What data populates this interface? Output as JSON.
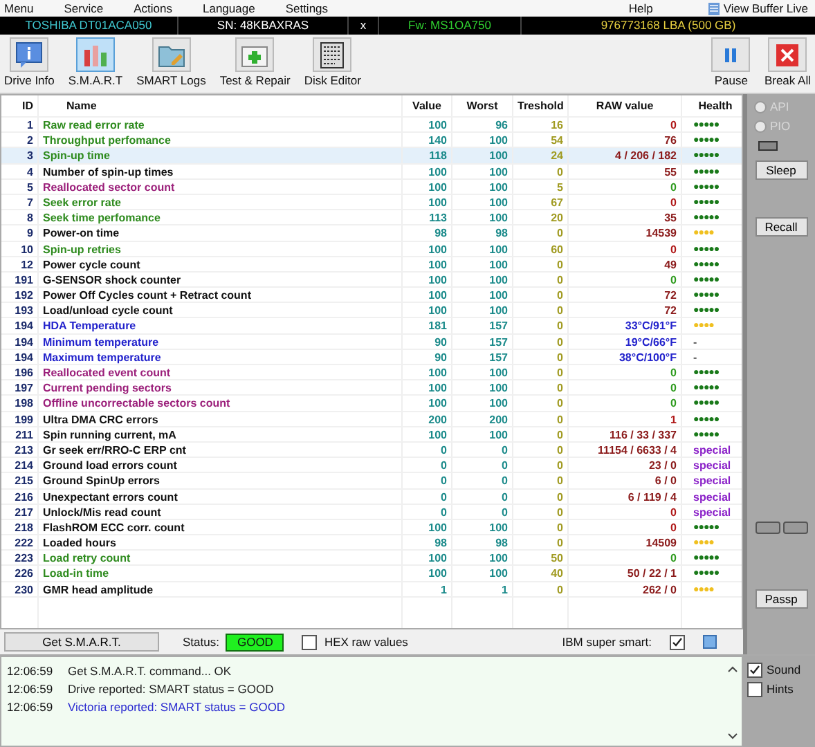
{
  "menu": [
    "Menu",
    "Service",
    "Actions",
    "Language",
    "Settings",
    "Help"
  ],
  "view_buffer": "View Buffer Live",
  "drive": {
    "model": "TOSHIBA DT01ACA050",
    "serial": "SN: 48KBAXRAS",
    "close": "x",
    "firmware": "Fw: MS1OA750",
    "capacity": "976773168 LBA (500 GB)"
  },
  "toolbar": [
    {
      "label": "Drive Info",
      "kind": "info",
      "selected": false
    },
    {
      "label": "S.M.A.R.T",
      "kind": "smart",
      "selected": true
    },
    {
      "label": "SMART Logs",
      "kind": "logs",
      "selected": false
    },
    {
      "label": "Test & Repair",
      "kind": "test",
      "selected": false
    },
    {
      "label": "Disk Editor",
      "kind": "editor",
      "selected": false
    }
  ],
  "toolbar_right": [
    {
      "label": "Pause",
      "kind": "pause"
    },
    {
      "label": "Break All",
      "kind": "break"
    }
  ],
  "table": {
    "columns": [
      "ID",
      "Name",
      "Value",
      "Worst",
      "Treshold",
      "RAW value",
      "Health"
    ],
    "rows": [
      {
        "id": "1",
        "name": {
          "text": "Raw read error rate",
          "color": "#2e8b1e"
        },
        "value": "100",
        "worst": "96",
        "threshold": "16",
        "raw": {
          "text": "0",
          "color": "#b01818"
        },
        "health": {
          "text": "●●●●●",
          "kind": "good"
        },
        "selected": false
      },
      {
        "id": "2",
        "name": {
          "text": "Throughput perfomance",
          "color": "#2e8b1e"
        },
        "value": "140",
        "worst": "100",
        "threshold": "54",
        "raw": {
          "text": "76",
          "color": "#8b1a1a"
        },
        "health": {
          "text": "●●●●●",
          "kind": "good"
        },
        "selected": false
      },
      {
        "id": "3",
        "name": {
          "text": "Spin-up time",
          "color": "#2e8b1e"
        },
        "value": "118",
        "worst": "100",
        "threshold": "24",
        "raw": {
          "text": "4 / 206 / 182",
          "color": "#8b1a1a"
        },
        "health": {
          "text": "●●●●●",
          "kind": "good"
        },
        "selected": true
      },
      {
        "id": "4",
        "name": {
          "text": "Number of spin-up times",
          "color": "#111111"
        },
        "value": "100",
        "worst": "100",
        "threshold": "0",
        "raw": {
          "text": "55",
          "color": "#8b1a1a"
        },
        "health": {
          "text": "●●●●●",
          "kind": "good"
        },
        "selected": false
      },
      {
        "id": "5",
        "name": {
          "text": "Reallocated sector count",
          "color": "#9b1f7a"
        },
        "value": "100",
        "worst": "100",
        "threshold": "5",
        "raw": {
          "text": "0",
          "color": "#2e9b1e"
        },
        "health": {
          "text": "●●●●●",
          "kind": "good"
        },
        "selected": false
      },
      {
        "id": "7",
        "name": {
          "text": "Seek error rate",
          "color": "#2e8b1e"
        },
        "value": "100",
        "worst": "100",
        "threshold": "67",
        "raw": {
          "text": "0",
          "color": "#b01818"
        },
        "health": {
          "text": "●●●●●",
          "kind": "good"
        },
        "selected": false
      },
      {
        "id": "8",
        "name": {
          "text": "Seek time perfomance",
          "color": "#2e8b1e"
        },
        "value": "113",
        "worst": "100",
        "threshold": "20",
        "raw": {
          "text": "35",
          "color": "#8b1a1a"
        },
        "health": {
          "text": "●●●●●",
          "kind": "good"
        },
        "selected": false
      },
      {
        "id": "9",
        "name": {
          "text": "Power-on time",
          "color": "#111111"
        },
        "value": "98",
        "worst": "98",
        "threshold": "0",
        "raw": {
          "text": "14539",
          "color": "#8b1a1a"
        },
        "health": {
          "text": "●●●●",
          "kind": "warn"
        },
        "selected": false
      },
      {
        "id": "10",
        "name": {
          "text": "Spin-up retries",
          "color": "#2e8b1e"
        },
        "value": "100",
        "worst": "100",
        "threshold": "60",
        "raw": {
          "text": "0",
          "color": "#b01818"
        },
        "health": {
          "text": "●●●●●",
          "kind": "good"
        },
        "selected": false
      },
      {
        "id": "12",
        "name": {
          "text": "Power cycle count",
          "color": "#111111"
        },
        "value": "100",
        "worst": "100",
        "threshold": "0",
        "raw": {
          "text": "49",
          "color": "#8b1a1a"
        },
        "health": {
          "text": "●●●●●",
          "kind": "good"
        },
        "selected": false
      },
      {
        "id": "191",
        "name": {
          "text": "G-SENSOR shock counter",
          "color": "#111111"
        },
        "value": "100",
        "worst": "100",
        "threshold": "0",
        "raw": {
          "text": "0",
          "color": "#2e9b1e"
        },
        "health": {
          "text": "●●●●●",
          "kind": "good"
        },
        "selected": false
      },
      {
        "id": "192",
        "name": {
          "text": "Power Off Cycles count + Retract count",
          "color": "#111111"
        },
        "value": "100",
        "worst": "100",
        "threshold": "0",
        "raw": {
          "text": "72",
          "color": "#8b1a1a"
        },
        "health": {
          "text": "●●●●●",
          "kind": "good"
        },
        "selected": false
      },
      {
        "id": "193",
        "name": {
          "text": "Load/unload cycle count",
          "color": "#111111"
        },
        "value": "100",
        "worst": "100",
        "threshold": "0",
        "raw": {
          "text": "72",
          "color": "#8b1a1a"
        },
        "health": {
          "text": "●●●●●",
          "kind": "good"
        },
        "selected": false
      },
      {
        "id": "194",
        "name": {
          "text": "HDA Temperature",
          "color": "#2222cc"
        },
        "value": "181",
        "worst": "157",
        "threshold": "0",
        "raw": {
          "text": "33°C/91°F",
          "color": "#2222cc"
        },
        "health": {
          "text": "●●●●",
          "kind": "warn"
        },
        "selected": false
      },
      {
        "id": "194",
        "name": {
          "text": "Minimum temperature",
          "color": "#2222cc"
        },
        "value": "90",
        "worst": "157",
        "threshold": "0",
        "raw": {
          "text": "19°C/66°F",
          "color": "#2222cc"
        },
        "health": {
          "text": "-",
          "kind": "none"
        },
        "selected": false
      },
      {
        "id": "194",
        "name": {
          "text": "Maximum temperature",
          "color": "#2222cc"
        },
        "value": "90",
        "worst": "157",
        "threshold": "0",
        "raw": {
          "text": "38°C/100°F",
          "color": "#2222cc"
        },
        "health": {
          "text": "-",
          "kind": "none"
        },
        "selected": false
      },
      {
        "id": "196",
        "name": {
          "text": "Reallocated event count",
          "color": "#9b1f7a"
        },
        "value": "100",
        "worst": "100",
        "threshold": "0",
        "raw": {
          "text": "0",
          "color": "#2e9b1e"
        },
        "health": {
          "text": "●●●●●",
          "kind": "good"
        },
        "selected": false
      },
      {
        "id": "197",
        "name": {
          "text": "Current pending sectors",
          "color": "#9b1f7a"
        },
        "value": "100",
        "worst": "100",
        "threshold": "0",
        "raw": {
          "text": "0",
          "color": "#2e9b1e"
        },
        "health": {
          "text": "●●●●●",
          "kind": "good"
        },
        "selected": false
      },
      {
        "id": "198",
        "name": {
          "text": "Offline uncorrectable sectors count",
          "color": "#9b1f7a"
        },
        "value": "100",
        "worst": "100",
        "threshold": "0",
        "raw": {
          "text": "0",
          "color": "#2e9b1e"
        },
        "health": {
          "text": "●●●●●",
          "kind": "good"
        },
        "selected": false
      },
      {
        "id": "199",
        "name": {
          "text": "Ultra DMA CRC errors",
          "color": "#111111"
        },
        "value": "200",
        "worst": "200",
        "threshold": "0",
        "raw": {
          "text": "1",
          "color": "#b01818"
        },
        "health": {
          "text": "●●●●●",
          "kind": "good"
        },
        "selected": false
      },
      {
        "id": "211",
        "name": {
          "text": "Spin running current, mA",
          "color": "#111111"
        },
        "value": "100",
        "worst": "100",
        "threshold": "0",
        "raw": {
          "text": "116 / 33 / 337",
          "color": "#8b1a1a"
        },
        "health": {
          "text": "●●●●●",
          "kind": "good"
        },
        "selected": false
      },
      {
        "id": "213",
        "name": {
          "text": "Gr seek err/RRO-C ERP cnt",
          "color": "#111111"
        },
        "value": "0",
        "worst": "0",
        "threshold": "0",
        "raw": {
          "text": "11154 / 6633 / 4",
          "color": "#8b1a1a"
        },
        "health": {
          "text": "special",
          "kind": "special"
        },
        "selected": false
      },
      {
        "id": "214",
        "name": {
          "text": "Ground load errors count",
          "color": "#111111"
        },
        "value": "0",
        "worst": "0",
        "threshold": "0",
        "raw": {
          "text": "23 / 0",
          "color": "#8b1a1a"
        },
        "health": {
          "text": "special",
          "kind": "special"
        },
        "selected": false
      },
      {
        "id": "215",
        "name": {
          "text": "Ground SpinUp errors",
          "color": "#111111"
        },
        "value": "0",
        "worst": "0",
        "threshold": "0",
        "raw": {
          "text": "6 / 0",
          "color": "#8b1a1a"
        },
        "health": {
          "text": "special",
          "kind": "special"
        },
        "selected": false
      },
      {
        "id": "216",
        "name": {
          "text": "Unexpectant errors count",
          "color": "#111111"
        },
        "value": "0",
        "worst": "0",
        "threshold": "0",
        "raw": {
          "text": "6 / 119 / 4",
          "color": "#8b1a1a"
        },
        "health": {
          "text": "special",
          "kind": "special"
        },
        "selected": false
      },
      {
        "id": "217",
        "name": {
          "text": "Unlock/Mis read count",
          "color": "#111111"
        },
        "value": "0",
        "worst": "0",
        "threshold": "0",
        "raw": {
          "text": "0",
          "color": "#b01818"
        },
        "health": {
          "text": "special",
          "kind": "special"
        },
        "selected": false
      },
      {
        "id": "218",
        "name": {
          "text": "FlashROM ECC corr. count",
          "color": "#111111"
        },
        "value": "100",
        "worst": "100",
        "threshold": "0",
        "raw": {
          "text": "0",
          "color": "#b01818"
        },
        "health": {
          "text": "●●●●●",
          "kind": "good"
        },
        "selected": false
      },
      {
        "id": "222",
        "name": {
          "text": "Loaded hours",
          "color": "#111111"
        },
        "value": "98",
        "worst": "98",
        "threshold": "0",
        "raw": {
          "text": "14509",
          "color": "#8b1a1a"
        },
        "health": {
          "text": "●●●●",
          "kind": "warn"
        },
        "selected": false
      },
      {
        "id": "223",
        "name": {
          "text": "Load retry count",
          "color": "#2e8b1e"
        },
        "value": "100",
        "worst": "100",
        "threshold": "50",
        "raw": {
          "text": "0",
          "color": "#2e9b1e"
        },
        "health": {
          "text": "●●●●●",
          "kind": "good"
        },
        "selected": false
      },
      {
        "id": "226",
        "name": {
          "text": "Load-in time",
          "color": "#2e8b1e"
        },
        "value": "100",
        "worst": "100",
        "threshold": "40",
        "raw": {
          "text": "50 / 22 / 1",
          "color": "#8b1a1a"
        },
        "health": {
          "text": "●●●●●",
          "kind": "good"
        },
        "selected": false
      },
      {
        "id": "230",
        "name": {
          "text": "GMR head amplitude",
          "color": "#111111"
        },
        "value": "1",
        "worst": "1",
        "threshold": "0",
        "raw": {
          "text": "262 / 0",
          "color": "#8b1a1a"
        },
        "health": {
          "text": "●●●●",
          "kind": "warn"
        },
        "selected": false
      }
    ]
  },
  "side": {
    "modes": [
      {
        "label": "API",
        "selected": false
      },
      {
        "label": "PIO",
        "selected": false
      }
    ],
    "buttons": [
      "Sleep",
      "Recall"
    ],
    "passp": "Passp"
  },
  "status_bar": {
    "get_button": "Get S.M.A.R.T.",
    "status_label": "Status:",
    "status": "GOOD",
    "hex": {
      "label": "HEX raw values",
      "checked": false
    },
    "ibm": {
      "label": "IBM super smart:",
      "checked": true
    }
  },
  "log": [
    {
      "time": "12:06:59",
      "text": "Get S.M.A.R.T. command... OK",
      "kind": "normal"
    },
    {
      "time": "12:06:59",
      "text": "Drive reported: SMART status = GOOD",
      "kind": "normal"
    },
    {
      "time": "12:06:59",
      "text": "Victoria reported: SMART status = GOOD",
      "kind": "info"
    }
  ],
  "options": [
    {
      "label": "Sound",
      "checked": true
    },
    {
      "label": "Hints",
      "checked": false
    }
  ]
}
